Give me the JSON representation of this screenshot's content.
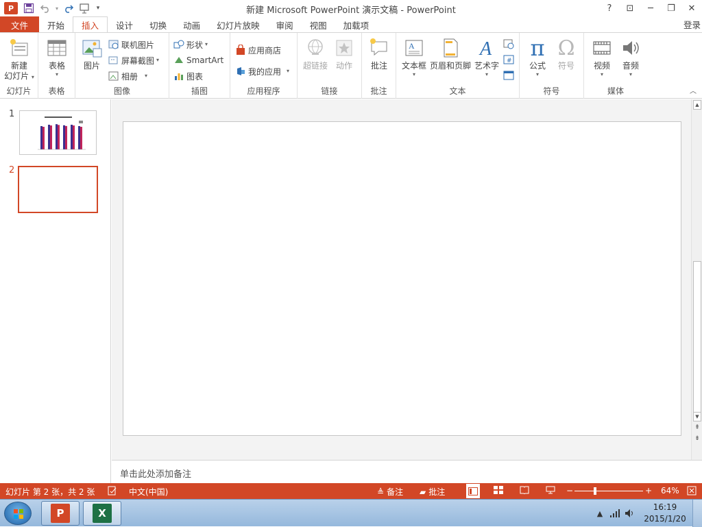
{
  "window": {
    "title": "新建 Microsoft PowerPoint 演示文稿 - PowerPoint",
    "app_logo": "P",
    "controls": {
      "help": "?",
      "ribbon_display": "⊡",
      "minimize": "─",
      "restore": "❐",
      "close": "✕"
    }
  },
  "qat": {
    "save": "save-icon",
    "undo": "undo-icon",
    "redo": "redo-icon",
    "present": "present-from-start-icon",
    "customize": "▾"
  },
  "tabs": [
    "文件",
    "开始",
    "插入",
    "设计",
    "切换",
    "动画",
    "幻灯片放映",
    "审阅",
    "视图",
    "加载项"
  ],
  "active_tab": "插入",
  "signin": "登录",
  "ribbon": {
    "groups": {
      "slides": "幻灯片",
      "tables": "表格",
      "images": "图像",
      "illustrations": "插图",
      "apps": "应用程序",
      "links": "链接",
      "comments": "批注",
      "text": "文本",
      "symbols": "符号",
      "media": "媒体"
    },
    "new_slide": [
      "新建",
      "幻灯片"
    ],
    "table": "表格",
    "picture": "图片",
    "online_pictures": "联机图片",
    "screenshot": "屏幕截图",
    "album": "相册",
    "shapes": "形状",
    "smartart": "SmartArt",
    "chart": "图表",
    "store": "应用商店",
    "my_apps": "我的应用",
    "hyperlink": "超链接",
    "action": "动作",
    "comment": "批注",
    "textbox": "文本框",
    "header_footer": "页眉和页脚",
    "wordart": "艺术字",
    "equation": "公式",
    "symbol": "符号",
    "video": "视频",
    "audio": "音频"
  },
  "slides": {
    "numbers": [
      "1",
      "2"
    ],
    "selected": 2
  },
  "notes_placeholder": "单击此处添加备注",
  "status": {
    "slide_info": "幻灯片 第 2 张，共 2 张",
    "language": "中文(中国)",
    "notes": "备注",
    "comments": "批注",
    "zoom": "64%",
    "zoom_level": 0.64
  },
  "taskbar": {
    "time": "16:19",
    "date": "2015/1/20",
    "apps": [
      "PowerPoint",
      "Excel"
    ]
  },
  "colors": {
    "accent": "#d24726",
    "excel": "#1e7145",
    "pi": "#2f6fb3"
  },
  "chart_thumb_values": [
    0.85,
    0.9,
    0.92,
    0.88,
    0.9,
    0.85
  ]
}
